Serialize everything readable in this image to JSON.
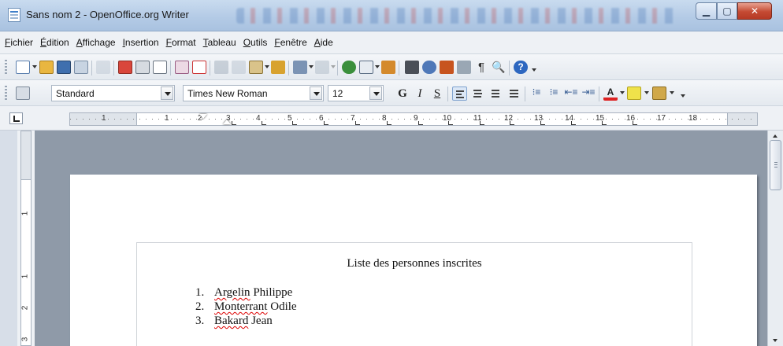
{
  "window": {
    "title": "Sans nom 2 - OpenOffice.org Writer",
    "controls": [
      "minimize-icon",
      "maximize-icon",
      "close-icon"
    ]
  },
  "menu": {
    "items": [
      "Fichier",
      "Édition",
      "Affichage",
      "Insertion",
      "Format",
      "Tableau",
      "Outils",
      "Fenêtre",
      "Aide"
    ]
  },
  "formatting": {
    "style": "Standard",
    "font": "Times New Roman",
    "size": "12",
    "bold": "G",
    "italic": "I",
    "underline": "S"
  },
  "ruler": {
    "labels": [
      "1",
      "1",
      "2",
      "3",
      "4",
      "5",
      "6",
      "7",
      "8",
      "9",
      "10",
      "11",
      "12",
      "13",
      "14",
      "15",
      "16",
      "17",
      "18"
    ],
    "vertical_labels": [
      "1",
      "1",
      "2",
      "3"
    ]
  },
  "document": {
    "title": "Liste des personnes inscrites",
    "items": [
      {
        "num": "1.",
        "surname": "Argelin",
        "firstname": "Philippe"
      },
      {
        "num": "2.",
        "surname": "Monterrant",
        "firstname": "Odile"
      },
      {
        "num": "3.",
        "surname": "Bakard",
        "firstname": "Jean"
      }
    ]
  },
  "colors": {
    "titlebar": "#b4cbe6",
    "workspace": "#8f9aa8",
    "close_button": "#c44a33"
  }
}
